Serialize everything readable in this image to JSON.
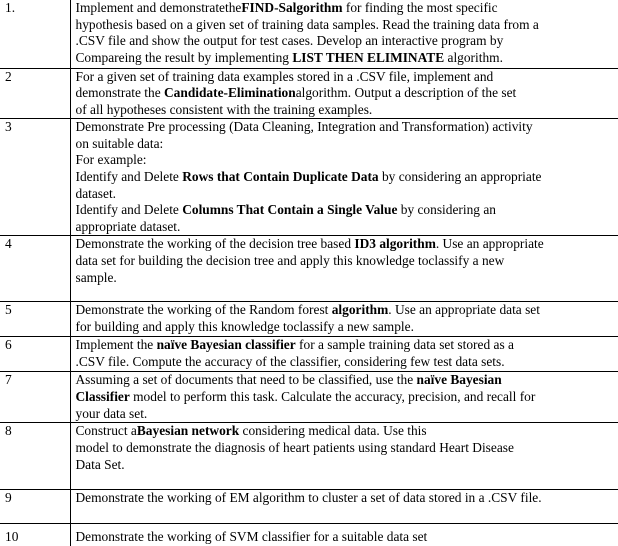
{
  "rows": [
    {
      "num": "1.",
      "lines": [
        [
          {
            "t": "Implement and demonstratethe"
          },
          {
            "t": "FIND-S",
            "b": true
          },
          {
            "t": "algorithm",
            "b": true
          },
          {
            "t": " for finding the most specific"
          }
        ],
        [
          {
            "t": "hypothesis based on a given set of training data samples. Read the training data from a"
          }
        ],
        [
          {
            "t": ".CSV file and show the output for test cases. Develop an interactive program by"
          }
        ],
        [
          {
            "t": "Compareing  the result by implementing "
          },
          {
            "t": "LIST THEN ELIMINATE",
            "b": true
          },
          {
            "t": " algorithm."
          }
        ]
      ]
    },
    {
      "num": "2",
      "lines": [
        [
          {
            "t": "For a given set of training data examples stored in a .CSV file, implement and"
          }
        ],
        [
          {
            "t": "demonstrate the "
          },
          {
            "t": "Candidate-Elimination",
            "b": true
          },
          {
            "t": "algorithm. Output a description of the set"
          }
        ],
        [
          {
            "t": "of all hypotheses consistent with the training examples."
          }
        ]
      ]
    },
    {
      "num": "3",
      "lines": [
        [
          {
            "t": "Demonstrate Pre processing (Data Cleaning, Integration and Transformation) activity"
          }
        ],
        [
          {
            "t": "on suitable data:"
          }
        ],
        [
          {
            "t": "For example:"
          }
        ],
        [
          {
            "t": "Identify and Delete "
          },
          {
            "t": "Rows that Contain Duplicate Data",
            "b": true
          },
          {
            "t": " by considering an appropriate"
          }
        ],
        [
          {
            "t": "dataset."
          }
        ],
        [
          {
            "t": "Identify and Delete "
          },
          {
            "t": "Columns That Contain a Single Value",
            "b": true
          },
          {
            "t": " by considering an"
          }
        ],
        [
          {
            "t": "appropriate dataset."
          }
        ]
      ]
    },
    {
      "num": "4",
      "lines": [
        [
          {
            "t": "Demonstrate the working of the decision tree based "
          },
          {
            "t": "ID3 algorithm",
            "b": true
          },
          {
            "t": ". Use an appropriate"
          }
        ],
        [
          {
            "t": "data set for building the decision tree and apply this knowledge toclassify a new"
          }
        ],
        [
          {
            "t": "sample."
          }
        ]
      ]
    },
    {
      "num": "5",
      "lines": [
        [
          {
            "t": "Demonstrate the working of the Random forest "
          },
          {
            "t": "algorithm",
            "b": true
          },
          {
            "t": ". Use an appropriate data set"
          }
        ],
        [
          {
            "t": "for building and apply this knowledge toclassify a new sample."
          }
        ]
      ]
    },
    {
      "num": "6",
      "lines": [
        [
          {
            "t": "Implement the "
          },
          {
            "t": "naïve Bayesian classifier",
            "b": true
          },
          {
            "t": " for a sample training data set stored as a"
          }
        ],
        [
          {
            "t": ".CSV file. Compute the accuracy of the classifier, considering few test data sets."
          }
        ]
      ]
    },
    {
      "num": "7",
      "lines": [
        [
          {
            "t": "Assuming a set of documents that need to be classified, use the "
          },
          {
            "t": "naïve Bayesian",
            "b": true
          }
        ],
        [
          {
            "t": "Classifier",
            "b": true
          },
          {
            "t": " model to perform this task. Calculate the accuracy, precision, and recall for"
          }
        ],
        [
          {
            "t": "your data set."
          }
        ]
      ]
    },
    {
      "num": "8",
      "lines": [
        [
          {
            "t": "Construct a"
          },
          {
            "t": "Bayesian network",
            "b": true
          },
          {
            "t": " considering medical data. Use this"
          }
        ],
        [
          {
            "t": "model to demonstrate the diagnosis of heart patients using standard Heart Disease"
          }
        ],
        [
          {
            "t": "Data Set."
          }
        ]
      ]
    },
    {
      "num": "9",
      "lines": [
        [
          {
            "t": "Demonstrate the working of EM algorithm to cluster a set of data stored in a .CSV file."
          }
        ]
      ]
    },
    {
      "num": "10",
      "lines": [
        [
          {
            "t": "Demonstrate the working of SVM classifier for a suitable data set"
          }
        ]
      ]
    }
  ]
}
